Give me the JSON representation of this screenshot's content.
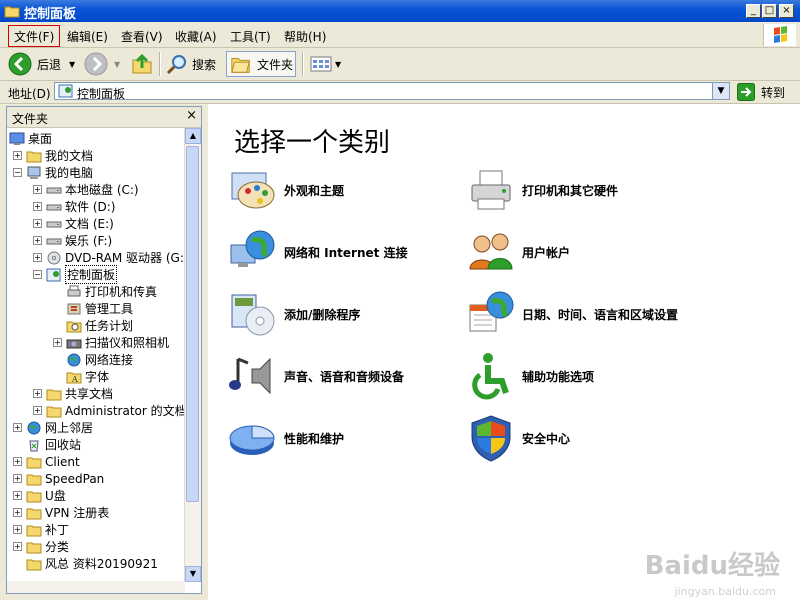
{
  "window": {
    "title": "控制面板"
  },
  "menu": [
    "文件(F)",
    "编辑(E)",
    "查看(V)",
    "收藏(A)",
    "工具(T)",
    "帮助(H)"
  ],
  "toolbar": {
    "back": "后退",
    "search": "搜索",
    "folders": "文件夹"
  },
  "address": {
    "label": "地址(D)",
    "value": "控制面板",
    "go": "转到"
  },
  "folders": {
    "title": "文件夹",
    "close": "×",
    "items": [
      "桌面",
      "我的文档",
      "我的电脑",
      "本地磁盘 (C:)",
      "软件 (D:)",
      "文档 (E:)",
      "娱乐 (F:)",
      "DVD-RAM 驱动器 (G:)",
      "控制面板",
      "打印机和传真",
      "管理工具",
      "任务计划",
      "扫描仪和照相机",
      "网络连接",
      "字体",
      "共享文档",
      "Administrator 的文档",
      "网上邻居",
      "回收站",
      "Client",
      "SpeedPan",
      "U盘",
      "VPN 注册表",
      "补丁",
      "分类",
      "风总 资料20190921"
    ]
  },
  "main": {
    "title": "选择一个类别",
    "categories": [
      "外观和主题",
      "打印机和其它硬件",
      "网络和 Internet 连接",
      "用户帐户",
      "添加/删除程序",
      "日期、时间、语言和区域设置",
      "声音、语音和音频设备",
      "辅助功能选项",
      "性能和维护",
      "安全中心"
    ]
  },
  "watermark": {
    "brand": "Baidu经验",
    "url": "jingyan.baidu.com"
  },
  "colors": {
    "titlebar": "#0a56d6",
    "chrome": "#ECE9D8",
    "selection_border": "#d00000"
  }
}
